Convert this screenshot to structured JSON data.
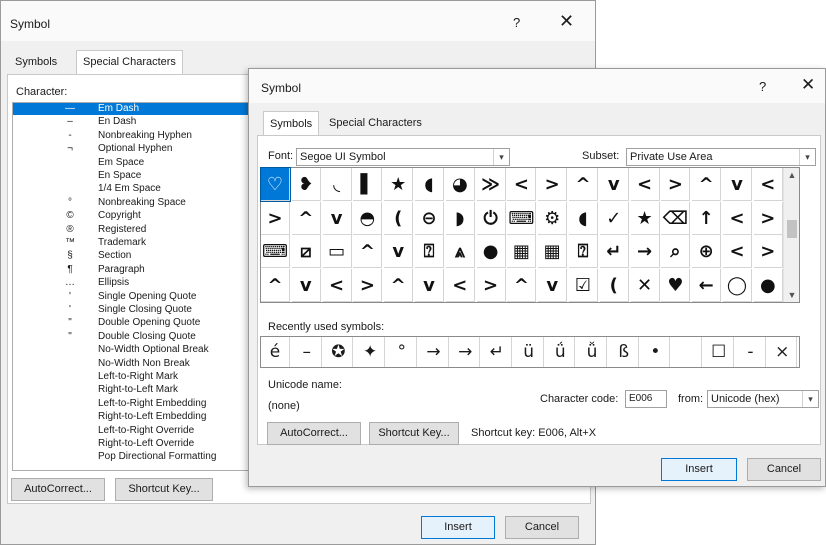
{
  "back_dialog": {
    "title": "Symbol",
    "help_glyph": "?",
    "close_glyph": "✕",
    "tab_symbols": "Symbols",
    "tab_special": "Special Characters",
    "character_label": "Character:",
    "special_characters": [
      {
        "glyph": "—",
        "name": "Em Dash"
      },
      {
        "glyph": "–",
        "name": "En Dash"
      },
      {
        "glyph": "-",
        "name": "Nonbreaking Hyphen"
      },
      {
        "glyph": "¬",
        "name": "Optional Hyphen"
      },
      {
        "glyph": "",
        "name": "Em Space"
      },
      {
        "glyph": "",
        "name": "En Space"
      },
      {
        "glyph": "",
        "name": "1/4 Em Space"
      },
      {
        "glyph": "°",
        "name": "Nonbreaking Space"
      },
      {
        "glyph": "©",
        "name": "Copyright"
      },
      {
        "glyph": "®",
        "name": "Registered"
      },
      {
        "glyph": "™",
        "name": "Trademark"
      },
      {
        "glyph": "§",
        "name": "Section"
      },
      {
        "glyph": "¶",
        "name": "Paragraph"
      },
      {
        "glyph": "…",
        "name": "Ellipsis"
      },
      {
        "glyph": "'",
        "name": "Single Opening Quote"
      },
      {
        "glyph": "'",
        "name": "Single Closing Quote"
      },
      {
        "glyph": "\"",
        "name": "Double Opening Quote"
      },
      {
        "glyph": "\"",
        "name": "Double Closing Quote"
      },
      {
        "glyph": "",
        "name": "No-Width Optional Break"
      },
      {
        "glyph": "",
        "name": "No-Width Non Break"
      },
      {
        "glyph": "",
        "name": "Left-to-Right Mark"
      },
      {
        "glyph": "",
        "name": "Right-to-Left Mark"
      },
      {
        "glyph": "",
        "name": "Left-to-Right Embedding"
      },
      {
        "glyph": "",
        "name": "Right-to-Left Embedding"
      },
      {
        "glyph": "",
        "name": "Left-to-Right Override"
      },
      {
        "glyph": "",
        "name": "Right-to-Left Override"
      },
      {
        "glyph": "",
        "name": "Pop Directional Formatting"
      }
    ],
    "autocorrect_label": "AutoCorrect...",
    "shortcut_key_label": "Shortcut Key...",
    "insert_label": "Insert",
    "cancel_label": "Cancel"
  },
  "front_dialog": {
    "title": "Symbol",
    "help_glyph": "?",
    "close_glyph": "✕",
    "tab_symbols": "Symbols",
    "tab_special": "Special Characters",
    "font_label": "Font:",
    "font_value": "Segoe UI Symbol",
    "subset_label": "Subset:",
    "subset_value": "Private Use Area",
    "dropdown_arrow": "▾",
    "symbol_grid": [
      [
        "♡",
        "❥",
        "◟",
        "▌",
        "★",
        "◖",
        "◕",
        "≫",
        "<",
        ">",
        "^",
        "v",
        "<",
        ">",
        "^",
        "v",
        "<"
      ],
      [
        ">",
        "^",
        "v",
        "◓",
        "(",
        "⊖",
        "◗",
        "⏻",
        "⌨",
        "⚙",
        "◖",
        "✓",
        "★",
        "⌫",
        "↑",
        "<",
        ">"
      ],
      [
        "⌨",
        "⧄",
        "▭",
        "^",
        "v",
        "⍰",
        "⩓",
        "●",
        "▦",
        "▦",
        "⍰",
        "↵",
        "→",
        "⌕",
        "⊕",
        "<",
        ">"
      ],
      [
        "^",
        "v",
        "<",
        ">",
        "^",
        "v",
        "<",
        ">",
        "^",
        "v",
        "☑",
        "(",
        "✕",
        "♥",
        "←",
        "◯",
        "●"
      ]
    ],
    "recently_used_label": "Recently used symbols:",
    "recent_symbols": [
      "é",
      "–",
      "✪",
      "✦",
      "°",
      "→",
      "→",
      "↵",
      "ü",
      "ǘ",
      "ǚ",
      "ß",
      "•",
      "",
      "☐",
      "-",
      "×"
    ],
    "unicode_name_label": "Unicode name:",
    "unicode_name_value": "(none)",
    "character_code_label": "Character code:",
    "character_code_value": "E006",
    "from_label": "from:",
    "from_value": "Unicode (hex)",
    "autocorrect_label": "AutoCorrect...",
    "shortcut_key_button_label": "Shortcut Key...",
    "shortcut_key_text": "Shortcut key: E006, Alt+X",
    "insert_label": "Insert",
    "cancel_label": "Cancel",
    "scroll_up_glyph": "▲",
    "scroll_down_glyph": "▼"
  }
}
